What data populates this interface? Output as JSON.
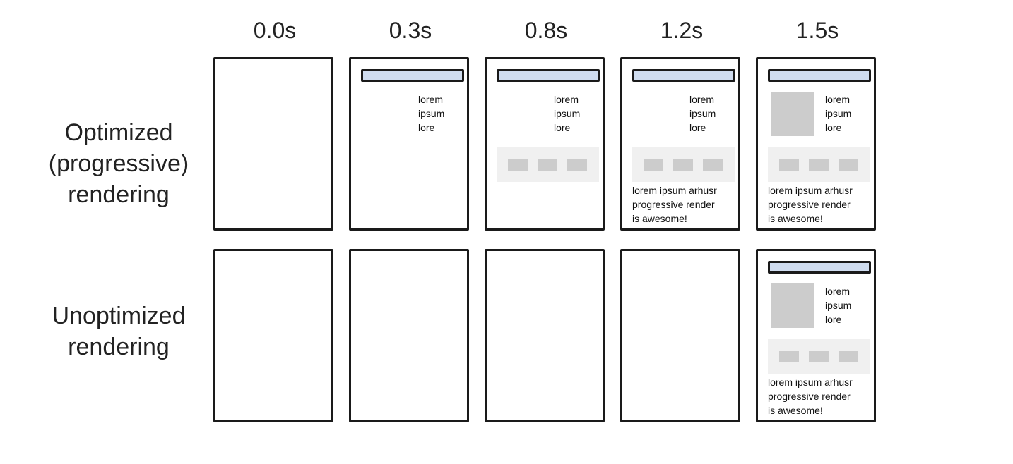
{
  "times": [
    "0.0s",
    "0.3s",
    "0.8s",
    "1.2s",
    "1.5s"
  ],
  "rows": [
    {
      "label": "Optimized\n(progressive)\nrendering",
      "frames": [
        {
          "header": false,
          "image": false,
          "side_text": false,
          "band": false,
          "paragraph": false
        },
        {
          "header": true,
          "image": false,
          "side_text": true,
          "band": false,
          "paragraph": false
        },
        {
          "header": true,
          "image": false,
          "side_text": true,
          "band": true,
          "paragraph": false
        },
        {
          "header": true,
          "image": false,
          "side_text": true,
          "band": true,
          "paragraph": true
        },
        {
          "header": true,
          "image": true,
          "side_text": true,
          "band": true,
          "paragraph": true
        }
      ]
    },
    {
      "label": "Unoptimized\nrendering",
      "frames": [
        {
          "header": false,
          "image": false,
          "side_text": false,
          "band": false,
          "paragraph": false
        },
        {
          "header": false,
          "image": false,
          "side_text": false,
          "band": false,
          "paragraph": false
        },
        {
          "header": false,
          "image": false,
          "side_text": false,
          "band": false,
          "paragraph": false
        },
        {
          "header": false,
          "image": false,
          "side_text": false,
          "band": false,
          "paragraph": false
        },
        {
          "header": true,
          "image": true,
          "side_text": true,
          "band": true,
          "paragraph": true
        }
      ]
    }
  ],
  "content": {
    "side_text": "lorem\nipsum\nlore",
    "paragraph": "lorem ipsum arhusr\nprogressive render\nis awesome!"
  },
  "colors": {
    "header_fill": "#cfdcef",
    "image_fill": "#cccccc",
    "band_fill": "#f0f0f0",
    "chip_fill": "#cccccc",
    "border": "#1a1a1a"
  }
}
